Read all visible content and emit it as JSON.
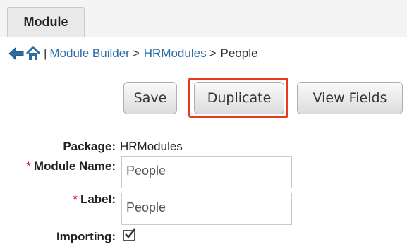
{
  "tab": {
    "label": "Module"
  },
  "breadcrumb": {
    "separator": "|",
    "items": [
      {
        "label": "Module Builder"
      },
      {
        "label": "HRModules"
      },
      {
        "label": "People"
      }
    ],
    "arrow": ">"
  },
  "toolbar": {
    "save_label": "Save",
    "duplicate_label": "Duplicate",
    "view_fields_label": "View Fields",
    "highlight_color": "#e63b1e"
  },
  "form": {
    "package_label": "Package:",
    "package_value": "HRModules",
    "module_name_label": "Module Name:",
    "module_name_value": "People",
    "label_label": "Label:",
    "label_value": "People",
    "importing_label": "Importing:",
    "importing_checked": true,
    "required_mark": "*"
  },
  "colors": {
    "link": "#2e6da4",
    "required": "#d0021b"
  }
}
